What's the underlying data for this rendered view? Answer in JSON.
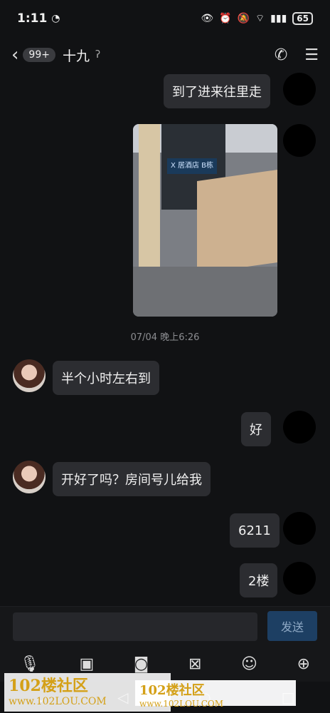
{
  "status_bar": {
    "time": "1:11",
    "battery": "65"
  },
  "header": {
    "unread_badge": "99+",
    "contact_name": "十九"
  },
  "messages": [
    {
      "side": "self",
      "type": "text",
      "text": "到了进来往里走"
    },
    {
      "side": "self",
      "type": "image",
      "sign_text": "X 居酒店 B栋"
    },
    {
      "type": "timestamp",
      "text": "07/04 晚上6:26"
    },
    {
      "side": "other",
      "type": "text",
      "text": "半个小时左右到"
    },
    {
      "side": "self",
      "type": "text",
      "text": "好"
    },
    {
      "side": "other",
      "type": "text",
      "text": "开好了吗？房间号儿给我"
    },
    {
      "side": "self",
      "type": "text",
      "text": "6211"
    },
    {
      "side": "self",
      "type": "text",
      "text": "2楼"
    }
  ],
  "input": {
    "placeholder": "",
    "send_label": "发送"
  },
  "toolbar": {
    "icons": [
      "mic-icon",
      "image-icon",
      "camera-icon",
      "red-packet-icon",
      "emoji-icon",
      "plus-icon"
    ]
  },
  "watermarks": [
    {
      "title": "102楼社区",
      "url": "www.102LOU.COM"
    },
    {
      "title": "102楼社区",
      "url": "www.102LOU.COM"
    }
  ]
}
